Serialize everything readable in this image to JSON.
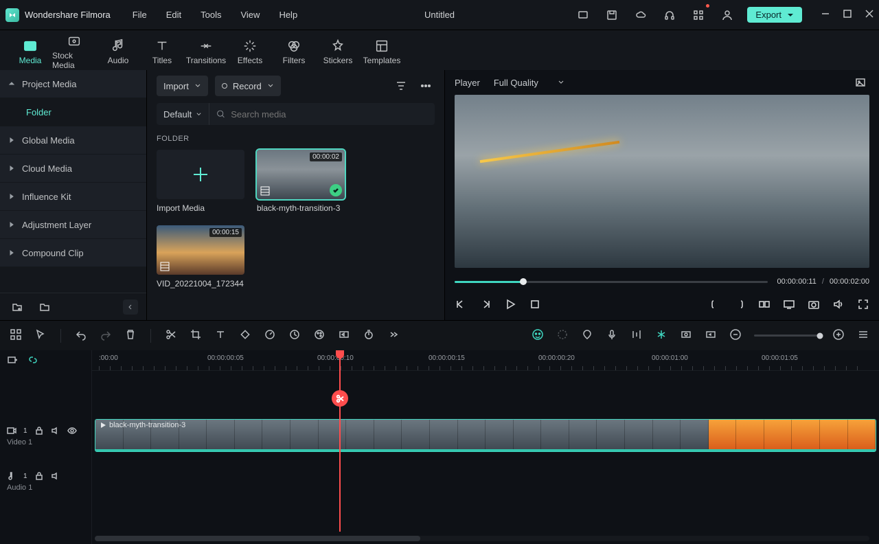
{
  "app_name": "Wondershare Filmora",
  "menu": {
    "file": "File",
    "edit": "Edit",
    "tools": "Tools",
    "view": "View",
    "help": "Help"
  },
  "doc_title": "Untitled",
  "export_label": "Export",
  "tools_tabs": {
    "media": "Media",
    "stock": "Stock Media",
    "audio": "Audio",
    "titles": "Titles",
    "transitions": "Transitions",
    "effects": "Effects",
    "filters": "Filters",
    "stickers": "Stickers",
    "templates": "Templates"
  },
  "left_nav": {
    "project": "Project Media",
    "folder": "Folder",
    "global": "Global Media",
    "cloud": "Cloud Media",
    "influence": "Influence Kit",
    "adjust": "Adjustment Layer",
    "compound": "Compound Clip"
  },
  "media_panel": {
    "import": "Import",
    "record": "Record",
    "sort_default": "Default",
    "search_placeholder": "Search media",
    "section": "FOLDER",
    "import_card": "Import Media",
    "clip1_name": "black-myth-transition-3",
    "clip1_dur": "00:00:02",
    "clip2_name": "VID_20221004_172344",
    "clip2_dur": "00:00:15"
  },
  "player": {
    "label": "Player",
    "quality": "Full Quality",
    "time_current": "00:00:00:11",
    "time_total": "00:00:02:00",
    "sep": "/"
  },
  "ruler": {
    "t0": ":00:00",
    "t1": "00:00:00:05",
    "t2": "00:00:00:10",
    "t3": "00:00:00:15",
    "t4": "00:00:00:20",
    "t5": "00:00:01:00",
    "t6": "00:00:01:05"
  },
  "tracks": {
    "video_name": "Video 1",
    "video_num": "1",
    "audio_name": "Audio 1",
    "audio_num": "1",
    "clip_label": "black-myth-transition-3"
  }
}
